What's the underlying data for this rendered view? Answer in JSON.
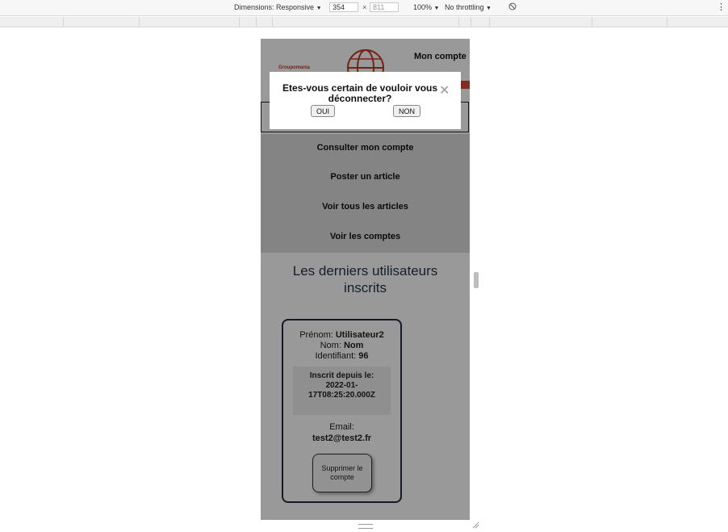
{
  "devtools": {
    "dimensions_label": "Dimensions: Responsive",
    "width_value": "354",
    "height_value": "811",
    "times_sign": "×",
    "zoom": "100%",
    "throttling": "No throttling",
    "dropdown_arrow": "▼",
    "no_throttle_icon": "rotate-icon",
    "menu_icon": "⋮"
  },
  "header": {
    "logo_text": "Groupomania",
    "account_link": "Mon compte"
  },
  "nav": {
    "items": [
      {
        "label": "Consulter mon compte"
      },
      {
        "label": "Poster un article"
      },
      {
        "label": "Voir tous les articles"
      },
      {
        "label": "Voir les comptes"
      }
    ]
  },
  "section": {
    "title_line1": "Les derniers utilisateurs",
    "title_line2": "inscrits"
  },
  "user_card": {
    "firstname_label": "Prénom:",
    "firstname_value": "Utilisateur2",
    "lastname_label": "Nom:",
    "lastname_value": "Nom",
    "id_label": "Identifiant:",
    "id_value": "96",
    "since_label": "Inscrit depuis le:",
    "since_line1": "2022-01-",
    "since_line2": "17T08:25:20.000Z",
    "email_label": "Email:",
    "email_value": "test2@test2.fr",
    "delete_button": "Supprimer le compte"
  },
  "modal": {
    "message": "Etes-vous certain de vouloir vous déconnecter?",
    "close_symbol": "✕",
    "yes_button": "OUI",
    "no_button": "NON"
  },
  "colors": {
    "overlay": "rgba(0,0,0,0.4)",
    "title": "#1f3346",
    "card_border": "#1e2d3d",
    "logo_red": "#c0392b"
  }
}
